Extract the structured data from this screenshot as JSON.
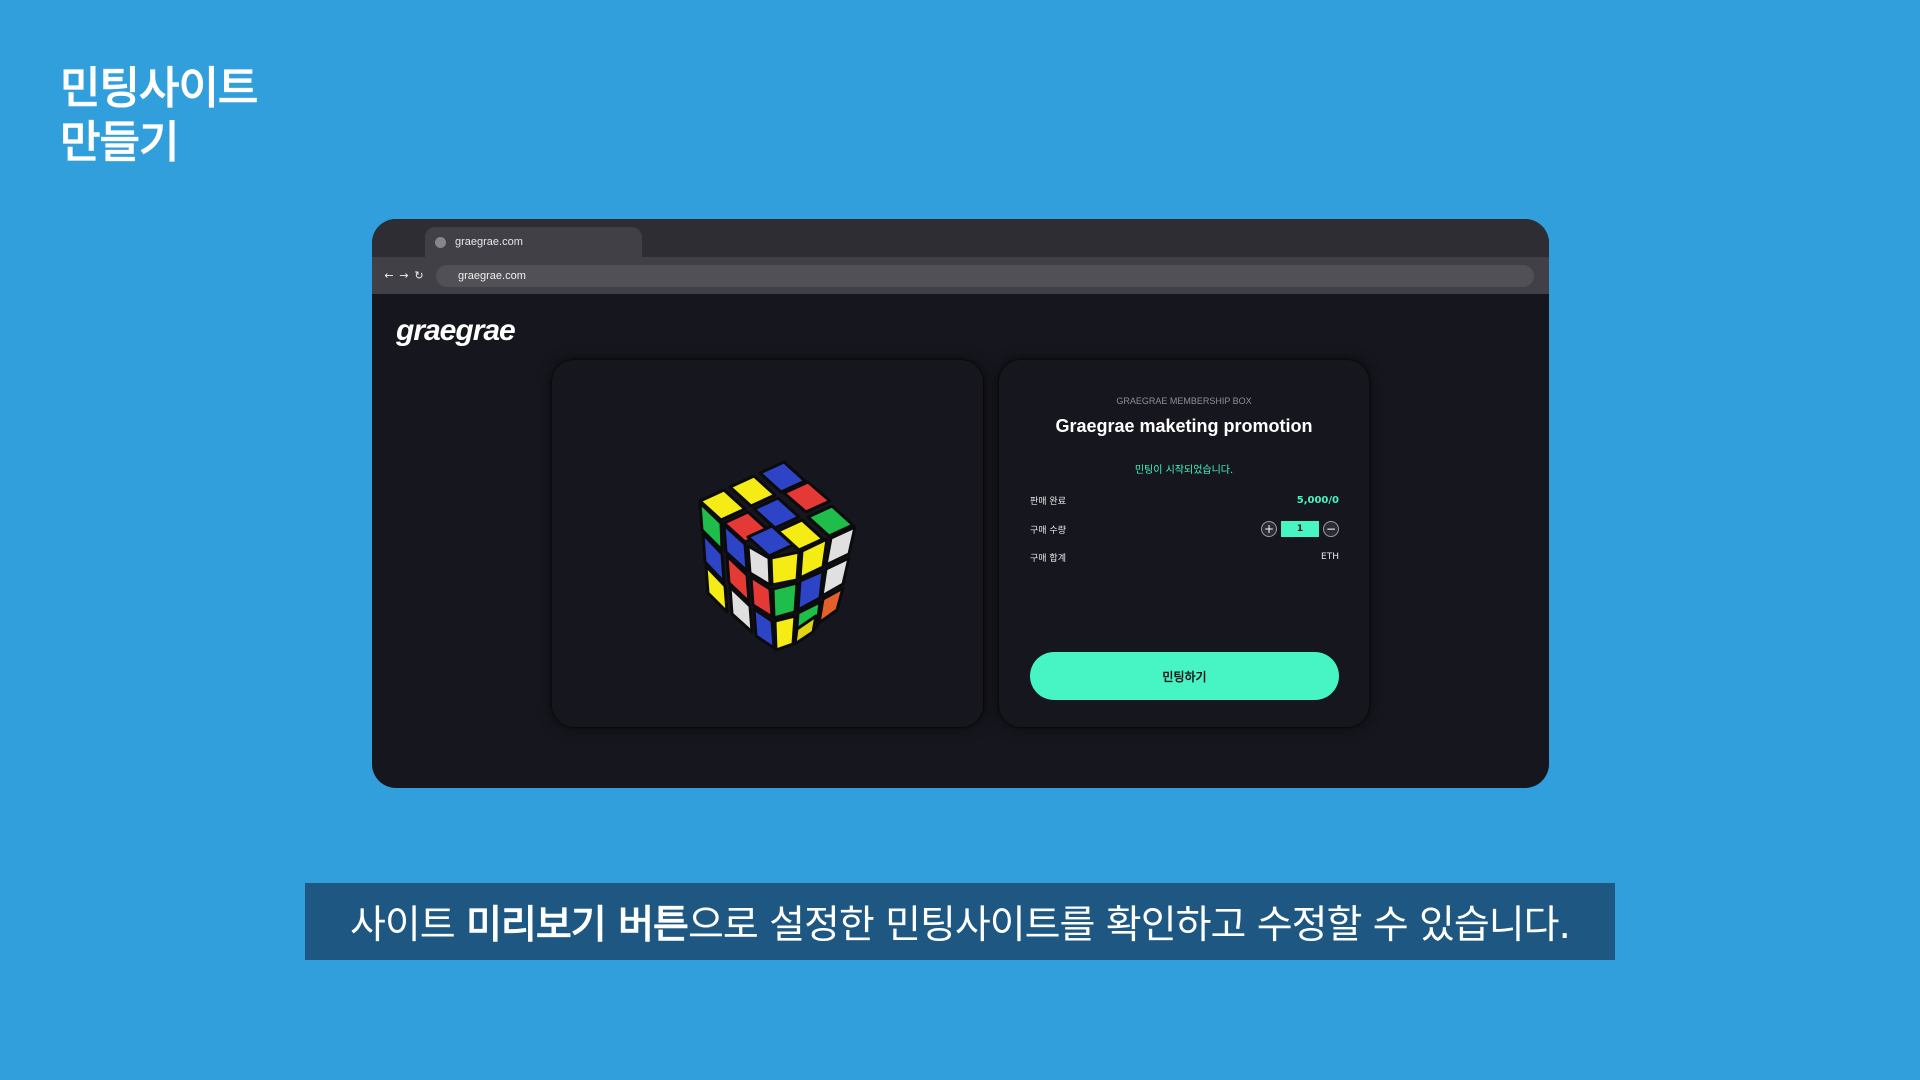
{
  "page_title": {
    "line1": "민팅사이트",
    "line2": "만들기"
  },
  "browser": {
    "tab_title": "graegrae.com",
    "url": "graegrae.com",
    "nav_icons": [
      "back-arrow-icon",
      "forward-arrow-icon",
      "reload-icon"
    ]
  },
  "site": {
    "logo": "graegrae",
    "box_label": "GRAEGRAE MEMBERSHIP BOX",
    "promo_title": "Graegrae maketing promotion",
    "status_text": "민팅이 시작되었습니다.",
    "rows": {
      "sold": {
        "label": "판매 완료",
        "value": "5,000/0"
      },
      "quantity": {
        "label": "구매 수량",
        "value": "1",
        "plus": "+",
        "minus": "−"
      },
      "total": {
        "label": "구매 합계",
        "value": "ETH"
      }
    },
    "mint_button": "민팅하기"
  },
  "caption": {
    "before": "사이트 ",
    "bold": "미리보기 버튼",
    "after": "으로 설정한 민팅사이트를 확인하고 수정할 수 있습니다."
  },
  "colors": {
    "background": "#319fdb",
    "accent": "#46f5c3",
    "dark": "#16161e",
    "caption_bar": "#1e5882"
  }
}
